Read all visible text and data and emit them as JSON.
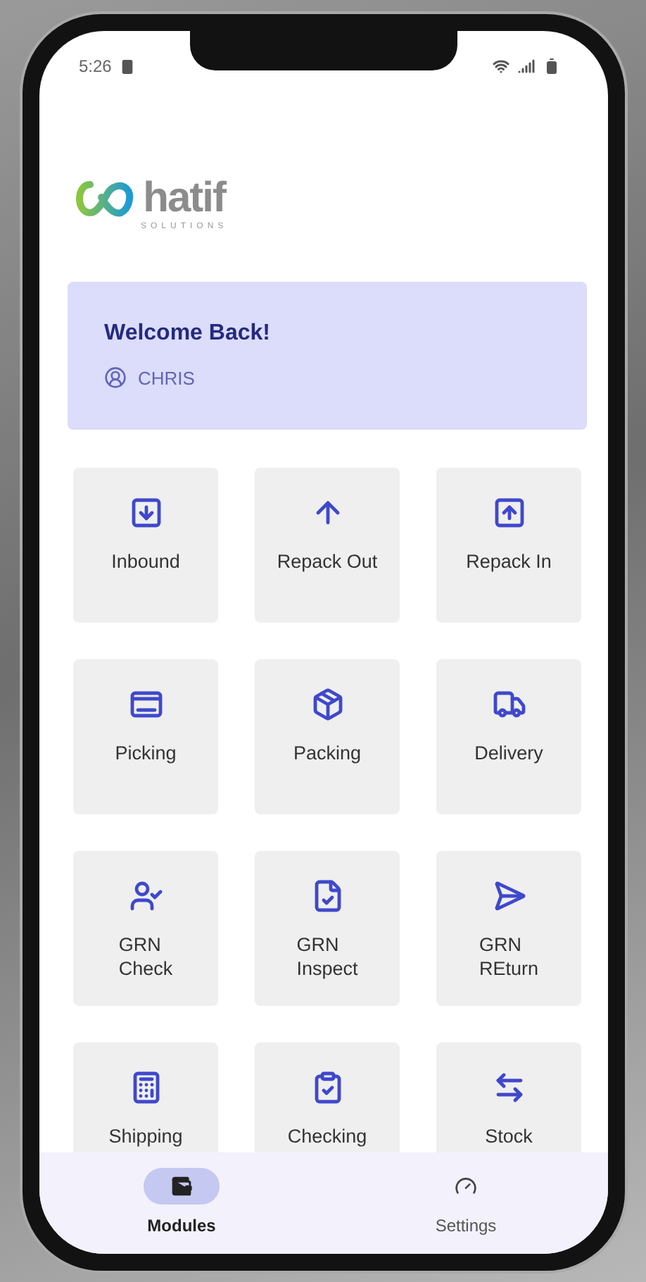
{
  "status_bar": {
    "time": "5:26"
  },
  "logo": {
    "wordmark": "hatif",
    "tagline": "SOLUTIONS"
  },
  "welcome": {
    "title": "Welcome Back!",
    "user": "CHRIS"
  },
  "modules": [
    {
      "label": "Inbound"
    },
    {
      "label": "Repack Out"
    },
    {
      "label": "Repack In"
    },
    {
      "label": "Picking"
    },
    {
      "label": "Packing"
    },
    {
      "label": "Delivery"
    },
    {
      "label": "GRN\nCheck"
    },
    {
      "label": "GRN\nInspect"
    },
    {
      "label": "GRN\nREturn"
    },
    {
      "label": "Shipping"
    },
    {
      "label": "Checking"
    },
    {
      "label": "Stock"
    }
  ],
  "bottom_nav": [
    {
      "label": "Modules",
      "selected": true
    },
    {
      "label": "Settings",
      "selected": false
    }
  ]
}
